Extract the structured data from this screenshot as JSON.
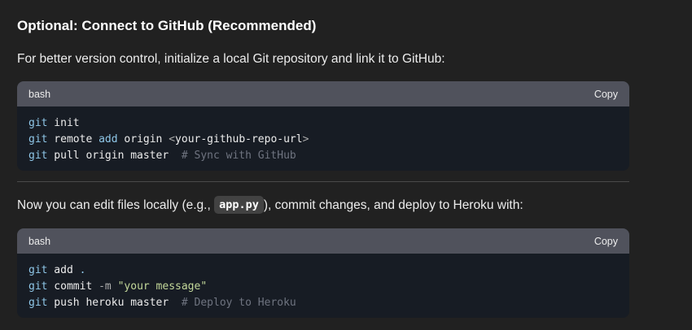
{
  "section": {
    "heading": "Optional: Connect to GitHub (Recommended)",
    "intro": "For better version control, initialize a local Git repository and link it to GitHub:",
    "para2": {
      "before": "Now you can edit files locally (e.g., ",
      "code": "app.py",
      "after": "), commit changes, and deploy to Heroku with:"
    }
  },
  "code_blocks": [
    {
      "language": "bash",
      "copy_label": "Copy",
      "lines": [
        {
          "cmd": "git",
          "rest": " init"
        },
        {
          "cmd": "git",
          "rest": " remote ",
          "kw": "add",
          "rest2": " origin ",
          "ph_open": "<",
          "ph": "your-github-repo-url",
          "ph_close": ">"
        },
        {
          "cmd": "git",
          "rest": " pull origin master  ",
          "comment": "# Sync with GitHub"
        }
      ]
    },
    {
      "language": "bash",
      "copy_label": "Copy",
      "lines": [
        {
          "cmd": "git",
          "rest": " add ",
          "kw": "."
        },
        {
          "cmd": "git",
          "rest": " commit ",
          "flag": "-m",
          "str": " \"your message\""
        },
        {
          "cmd": "git",
          "rest": " push heroku master  ",
          "comment": "# Deploy to Heroku"
        }
      ]
    }
  ]
}
